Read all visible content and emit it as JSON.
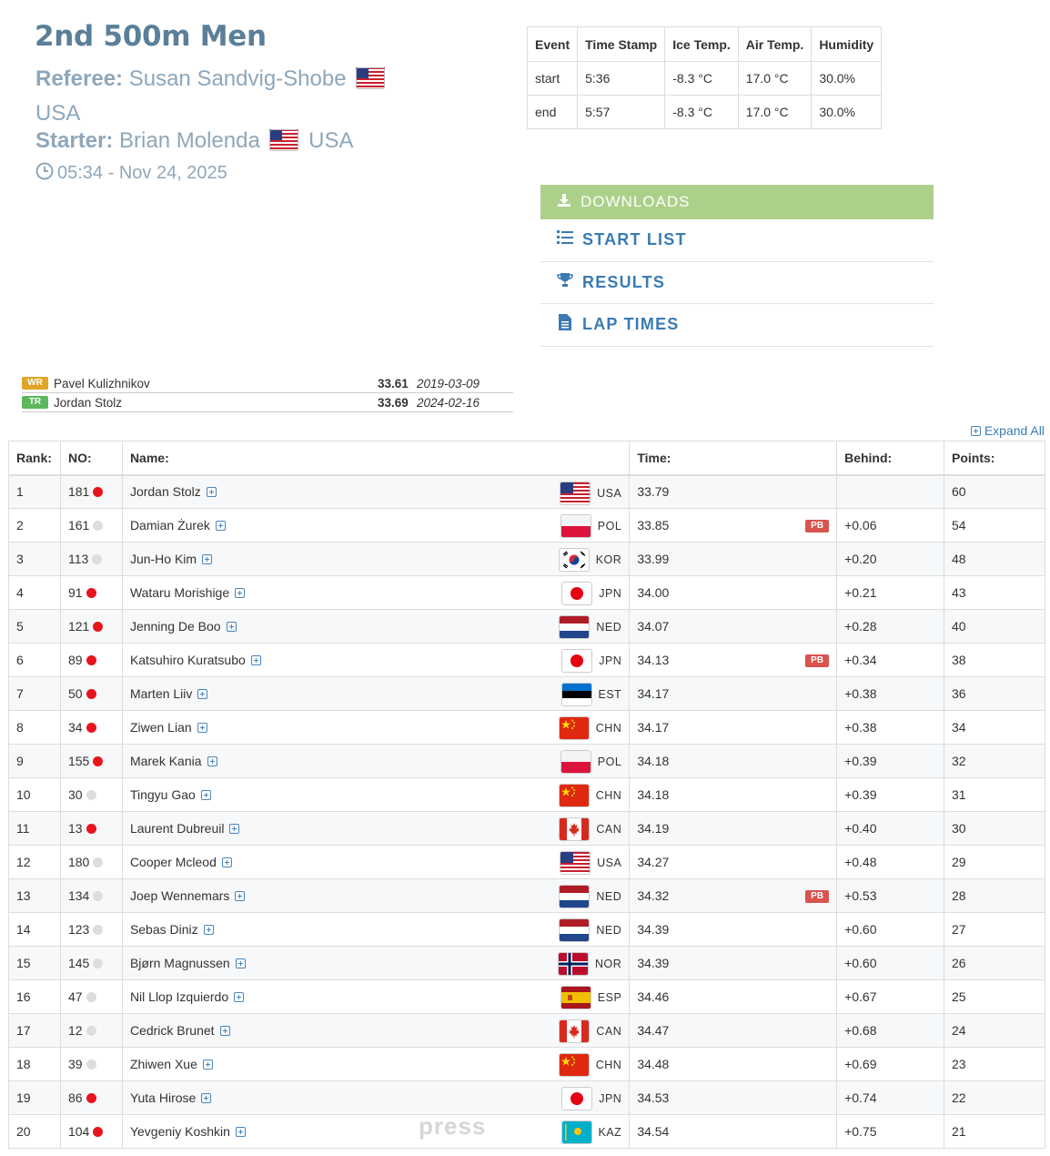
{
  "header": {
    "title": "2nd 500m Men",
    "referee_label": "Referee:",
    "referee_name": "Susan Sandvig-Shobe",
    "referee_country": "USA",
    "starter_label": "Starter:",
    "starter_name": "Brian Molenda",
    "starter_country": "USA",
    "datetime": "05:34 - Nov 24, 2025",
    "icons": {
      "clock": "clock-icon",
      "flag": "usa-flag-icon"
    }
  },
  "weather": {
    "headers": [
      "Event",
      "Time Stamp",
      "Ice Temp.",
      "Air Temp.",
      "Humidity"
    ],
    "rows": [
      [
        "start",
        "5:36",
        "-8.3 °C",
        "17.0 °C",
        "30.0%"
      ],
      [
        "end",
        "5:57",
        "-8.3 °C",
        "17.0 °C",
        "30.0%"
      ]
    ]
  },
  "downloads": {
    "header": "DOWNLOADS",
    "items": [
      {
        "label": "START LIST",
        "icon": "list-icon"
      },
      {
        "label": "RESULTS",
        "icon": "trophy-icon"
      },
      {
        "label": "LAP TIMES",
        "icon": "document-icon"
      }
    ]
  },
  "records": [
    {
      "badge": "WR",
      "color": "#e0a528",
      "name": "Pavel Kulizhnikov",
      "time": "33.61",
      "date": "2019-03-09"
    },
    {
      "badge": "TR",
      "color": "#5cb85c",
      "name": "Jordan Stolz",
      "time": "33.69",
      "date": "2024-02-16"
    }
  ],
  "expand_all": "Expand All",
  "colors": {
    "red_dot": "#e8141c",
    "grey_dot": "#dddddd",
    "link": "#3a7bb4",
    "downloads_bg": "#acd08a",
    "pb": "#d9534f"
  },
  "results": {
    "headers": [
      "Rank:",
      "NO:",
      "Name:",
      "Time:",
      "Behind:",
      "Points:"
    ],
    "rows": [
      {
        "rank": "1",
        "no": "181",
        "dot": "red",
        "name": "Jordan Stolz",
        "nation": "USA",
        "time": "33.79",
        "pb": "",
        "behind": "",
        "points": "60"
      },
      {
        "rank": "2",
        "no": "161",
        "dot": "grey",
        "name": "Damian Żurek",
        "nation": "POL",
        "time": "33.85",
        "pb": "PB",
        "behind": "+0.06",
        "points": "54"
      },
      {
        "rank": "3",
        "no": "113",
        "dot": "grey",
        "name": "Jun-Ho Kim",
        "nation": "KOR",
        "time": "33.99",
        "pb": "",
        "behind": "+0.20",
        "points": "48"
      },
      {
        "rank": "4",
        "no": "91",
        "dot": "red",
        "name": "Wataru Morishige",
        "nation": "JPN",
        "time": "34.00",
        "pb": "",
        "behind": "+0.21",
        "points": "43"
      },
      {
        "rank": "5",
        "no": "121",
        "dot": "red",
        "name": "Jenning De Boo",
        "nation": "NED",
        "time": "34.07",
        "pb": "",
        "behind": "+0.28",
        "points": "40"
      },
      {
        "rank": "6",
        "no": "89",
        "dot": "red",
        "name": "Katsuhiro Kuratsubo",
        "nation": "JPN",
        "time": "34.13",
        "pb": "PB",
        "behind": "+0.34",
        "points": "38"
      },
      {
        "rank": "7",
        "no": "50",
        "dot": "red",
        "name": "Marten Liiv",
        "nation": "EST",
        "time": "34.17",
        "pb": "",
        "behind": "+0.38",
        "points": "36"
      },
      {
        "rank": "8",
        "no": "34",
        "dot": "red",
        "name": "Ziwen Lian",
        "nation": "CHN",
        "time": "34.17",
        "pb": "",
        "behind": "+0.38",
        "points": "34"
      },
      {
        "rank": "9",
        "no": "155",
        "dot": "red",
        "name": "Marek Kania",
        "nation": "POL",
        "time": "34.18",
        "pb": "",
        "behind": "+0.39",
        "points": "32"
      },
      {
        "rank": "10",
        "no": "30",
        "dot": "grey",
        "name": "Tingyu Gao",
        "nation": "CHN",
        "time": "34.18",
        "pb": "",
        "behind": "+0.39",
        "points": "31"
      },
      {
        "rank": "11",
        "no": "13",
        "dot": "red",
        "name": "Laurent Dubreuil",
        "nation": "CAN",
        "time": "34.19",
        "pb": "",
        "behind": "+0.40",
        "points": "30"
      },
      {
        "rank": "12",
        "no": "180",
        "dot": "grey",
        "name": "Cooper Mcleod",
        "nation": "USA",
        "time": "34.27",
        "pb": "",
        "behind": "+0.48",
        "points": "29"
      },
      {
        "rank": "13",
        "no": "134",
        "dot": "grey",
        "name": "Joep Wennemars",
        "nation": "NED",
        "time": "34.32",
        "pb": "PB",
        "behind": "+0.53",
        "points": "28"
      },
      {
        "rank": "14",
        "no": "123",
        "dot": "grey",
        "name": "Sebas Diniz",
        "nation": "NED",
        "time": "34.39",
        "pb": "",
        "behind": "+0.60",
        "points": "27"
      },
      {
        "rank": "15",
        "no": "145",
        "dot": "grey",
        "name": "Bjørn Magnussen",
        "nation": "NOR",
        "time": "34.39",
        "pb": "",
        "behind": "+0.60",
        "points": "26"
      },
      {
        "rank": "16",
        "no": "47",
        "dot": "grey",
        "name": "Nil Llop Izquierdo",
        "nation": "ESP",
        "time": "34.46",
        "pb": "",
        "behind": "+0.67",
        "points": "25"
      },
      {
        "rank": "17",
        "no": "12",
        "dot": "grey",
        "name": "Cedrick Brunet",
        "nation": "CAN",
        "time": "34.47",
        "pb": "",
        "behind": "+0.68",
        "points": "24"
      },
      {
        "rank": "18",
        "no": "39",
        "dot": "grey",
        "name": "Zhiwen Xue",
        "nation": "CHN",
        "time": "34.48",
        "pb": "",
        "behind": "+0.69",
        "points": "23"
      },
      {
        "rank": "19",
        "no": "86",
        "dot": "red",
        "name": "Yuta Hirose",
        "nation": "JPN",
        "time": "34.53",
        "pb": "",
        "behind": "+0.74",
        "points": "22"
      },
      {
        "rank": "20",
        "no": "104",
        "dot": "red",
        "name": "Yevgeniy Koshkin",
        "nation": "KAZ",
        "time": "34.54",
        "pb": "",
        "behind": "+0.75",
        "points": "21"
      }
    ]
  },
  "watermark": "press"
}
